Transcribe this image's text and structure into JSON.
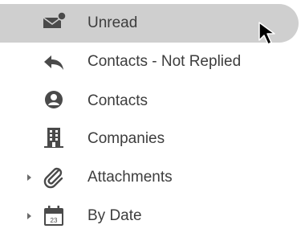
{
  "colors": {
    "selected_background": "#cfcfcf",
    "icon": "#4a4a4a",
    "text": "#3d3d3d"
  },
  "nav": {
    "items": [
      {
        "label": "Unread",
        "icon": "envelope-icon",
        "selected": true,
        "expandable": false
      },
      {
        "label": "Contacts - Not Replied",
        "icon": "reply-icon",
        "selected": false,
        "expandable": false
      },
      {
        "label": "Contacts",
        "icon": "contact-icon",
        "selected": false,
        "expandable": false
      },
      {
        "label": "Companies",
        "icon": "building-icon",
        "selected": false,
        "expandable": false
      },
      {
        "label": "Attachments",
        "icon": "paperclip-icon",
        "selected": false,
        "expandable": true
      },
      {
        "label": "By Date",
        "icon": "calendar-icon",
        "selected": false,
        "expandable": true,
        "icon_text": "23"
      }
    ]
  }
}
